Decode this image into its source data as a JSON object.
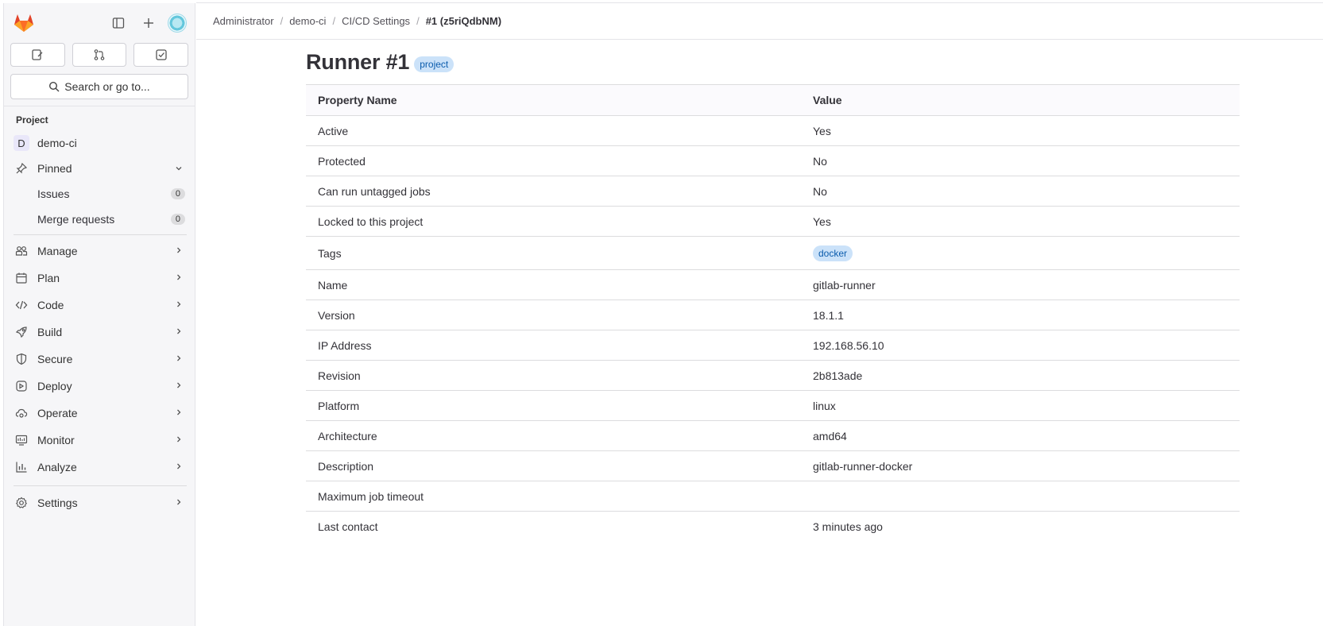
{
  "sidebar": {
    "search_label": "Search or go to...",
    "section_title": "Project",
    "project": {
      "letter": "D",
      "name": "demo-ci"
    },
    "pinned": {
      "label": "Pinned",
      "items": [
        {
          "label": "Issues",
          "count": "0"
        },
        {
          "label": "Merge requests",
          "count": "0"
        }
      ]
    },
    "items": [
      {
        "label": "Manage",
        "icon": "users-icon"
      },
      {
        "label": "Plan",
        "icon": "calendar-icon"
      },
      {
        "label": "Code",
        "icon": "code-icon"
      },
      {
        "label": "Build",
        "icon": "rocket-icon"
      },
      {
        "label": "Secure",
        "icon": "shield-icon"
      },
      {
        "label": "Deploy",
        "icon": "deploy-icon"
      },
      {
        "label": "Operate",
        "icon": "cloud-gear-icon"
      },
      {
        "label": "Monitor",
        "icon": "monitor-icon"
      },
      {
        "label": "Analyze",
        "icon": "chart-icon"
      }
    ],
    "settings_label": "Settings"
  },
  "breadcrumb": [
    "Administrator",
    "demo-ci",
    "CI/CD Settings",
    "#1 (z5riQdbNM)"
  ],
  "page": {
    "title": "Runner #1",
    "badge": "project"
  },
  "table": {
    "headers": [
      "Property Name",
      "Value"
    ],
    "rows": [
      {
        "name": "Active",
        "value": "Yes"
      },
      {
        "name": "Protected",
        "value": "No"
      },
      {
        "name": "Can run untagged jobs",
        "value": "No"
      },
      {
        "name": "Locked to this project",
        "value": "Yes"
      },
      {
        "name": "Tags",
        "value": "docker"
      },
      {
        "name": "Name",
        "value": "gitlab-runner"
      },
      {
        "name": "Version",
        "value": "18.1.1"
      },
      {
        "name": "IP Address",
        "value": "192.168.56.10"
      },
      {
        "name": "Revision",
        "value": "2b813ade"
      },
      {
        "name": "Platform",
        "value": "linux"
      },
      {
        "name": "Architecture",
        "value": "amd64"
      },
      {
        "name": "Description",
        "value": "gitlab-runner-docker"
      },
      {
        "name": "Maximum job timeout",
        "value": ""
      },
      {
        "name": "Last contact",
        "value": "3 minutes ago"
      }
    ]
  },
  "colors": {
    "brand": "#e24329",
    "badge_bg": "#cbe2f9",
    "badge_text": "#0b5cad"
  }
}
